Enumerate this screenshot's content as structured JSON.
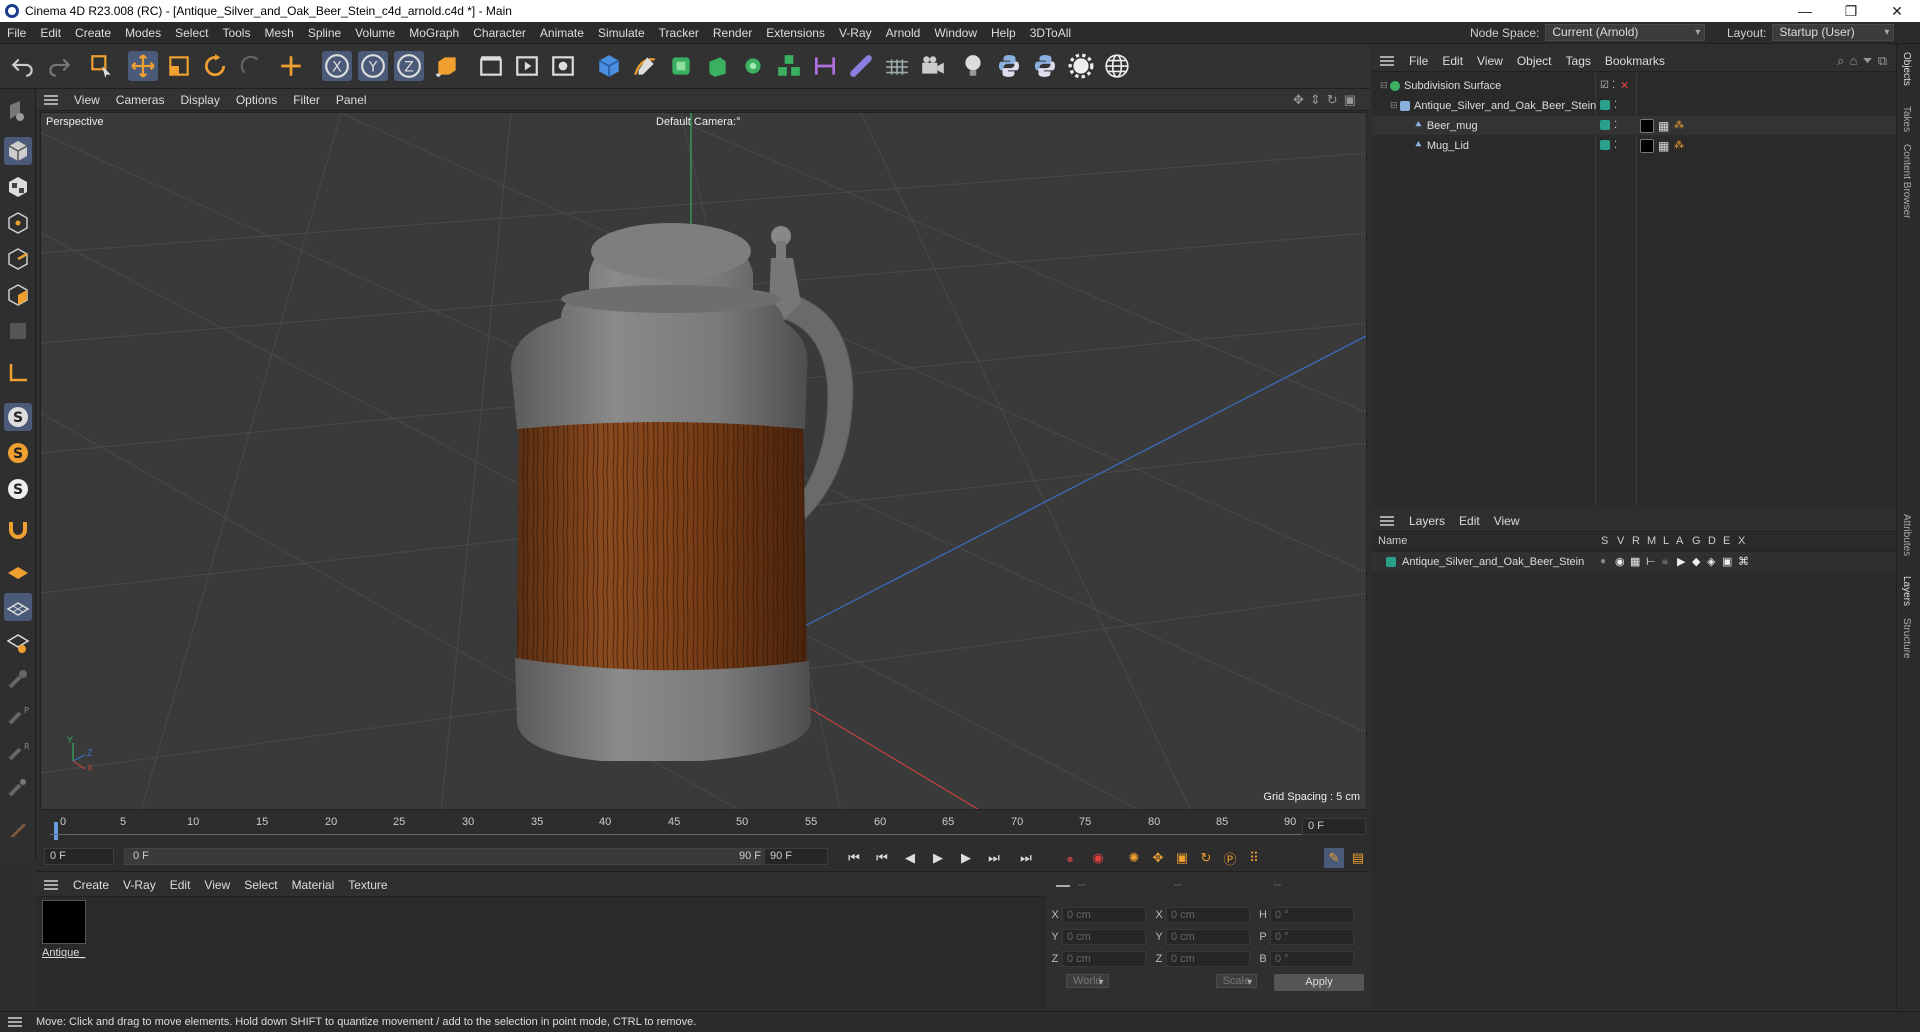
{
  "window": {
    "title": "Cinema 4D R23.008 (RC) - [Antique_Silver_and_Oak_Beer_Stein_c4d_arnold.c4d *] - Main",
    "min": "—",
    "max": "❐",
    "close": "✕"
  },
  "menu": [
    "File",
    "Edit",
    "Create",
    "Modes",
    "Select",
    "Tools",
    "Mesh",
    "Spline",
    "Volume",
    "MoGraph",
    "Character",
    "Animate",
    "Simulate",
    "Tracker",
    "Render",
    "Extensions",
    "V-Ray",
    "Arnold",
    "Window",
    "Help",
    "3DToAll"
  ],
  "node_space": {
    "label": "Node Space:",
    "value": "Current (Arnold)"
  },
  "layout": {
    "label": "Layout:",
    "value": "Startup (User)"
  },
  "viewport": {
    "menu": [
      "View",
      "Cameras",
      "Display",
      "Options",
      "Filter",
      "Panel"
    ],
    "projection": "Perspective",
    "camera": "Default Camera",
    "camera_suffix": ":°",
    "grid_spacing": "Grid Spacing : 5 cm",
    "axis_y": "Y",
    "axis_z": "Z",
    "axis_x": "X"
  },
  "timeline": {
    "ticks": [
      "0",
      "5",
      "10",
      "15",
      "20",
      "25",
      "30",
      "35",
      "40",
      "45",
      "50",
      "55",
      "60",
      "65",
      "70",
      "75",
      "80",
      "85",
      "90"
    ],
    "current_frame": "0 F",
    "start_field": "0 F",
    "range_start": "0 F",
    "range_end": "90 F",
    "end_field": "90 F",
    "right_frame": "0 F"
  },
  "material_menu": [
    "Create",
    "V-Ray",
    "Edit",
    "View",
    "Select",
    "Material",
    "Texture"
  ],
  "material": {
    "name": "Antique_"
  },
  "coords": {
    "header": [
      "--",
      "--",
      "--"
    ],
    "rows": [
      {
        "a": "X",
        "av": "0 cm",
        "b": "X",
        "bv": "0 cm",
        "c": "H",
        "cv": "0 °"
      },
      {
        "a": "Y",
        "av": "0 cm",
        "b": "Y",
        "bv": "0 cm",
        "c": "P",
        "cv": "0 °"
      },
      {
        "a": "Z",
        "av": "0 cm",
        "b": "Z",
        "bv": "0 cm",
        "c": "B",
        "cv": "0 °"
      }
    ],
    "mode1": "World",
    "mode2": "Scale",
    "apply": "Apply"
  },
  "status": "Move: Click and drag to move elements. Hold down SHIFT to quantize movement / add to the selection in point mode, CTRL to remove.",
  "objects": {
    "menu": [
      "File",
      "Edit",
      "View",
      "Object",
      "Tags",
      "Bookmarks"
    ],
    "items": [
      {
        "name": "Subdivision Surface",
        "indent": 0
      },
      {
        "name": "Antique_Silver_and_Oak_Beer_Stein",
        "indent": 1
      },
      {
        "name": "Beer_mug",
        "indent": 2
      },
      {
        "name": "Mug_Lid",
        "indent": 2
      }
    ]
  },
  "layers": {
    "menu": [
      "Layers",
      "Edit",
      "View"
    ],
    "header_name": "Name",
    "columns": [
      "S",
      "V",
      "R",
      "M",
      "L",
      "A",
      "G",
      "D",
      "E",
      "X"
    ],
    "items": [
      {
        "name": "Antique_Silver_and_Oak_Beer_Stein"
      }
    ]
  },
  "side_tabs": [
    "Objects",
    "Takes",
    "Content Browser",
    "Attributes",
    "Layers",
    "Structure"
  ],
  "colors": {
    "accent": "#4a5a78",
    "layer_green": "#2aa08a",
    "axis_x": "#c04040",
    "axis_y": "#30b060",
    "axis_z": "#3a70c8"
  }
}
